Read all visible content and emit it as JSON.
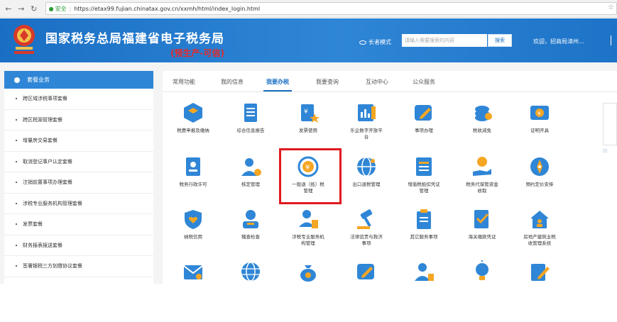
{
  "browser": {
    "security_label": "安全",
    "url": "https://etax99.fujian.chinatax.gov.cn/xxmh/html/index_login.html"
  },
  "header": {
    "title": "国家税务总局福建省电子税务局",
    "subtitle": "(预生产-可信)",
    "elder_mode": "长者模式",
    "search_placeholder": "请输入需要搜索的内容",
    "search_button": "搜索",
    "welcome": "欢迎，招商局漳州..."
  },
  "sidebar": {
    "title": "套餐业务",
    "items": [
      "跨区域涉税事项套餐",
      "跨区税源管理套餐",
      "增量房交易套餐",
      "取消登记事户认定套餐",
      "注销前置事项办理套餐",
      "涉税专业服务机构管理套餐",
      "发票套餐",
      "财务报表报送套餐",
      "签署银税三方划缴协议套餐"
    ]
  },
  "tabs": [
    "常用功能",
    "我的信息",
    "我要办税",
    "我要查询",
    "互动中心",
    "公众服务"
  ],
  "tiles": [
    {
      "label": "税费申报及缴纳",
      "icon": "cube-icon"
    },
    {
      "label": "综合信息报告",
      "icon": "document-icon"
    },
    {
      "label": "发票使用",
      "icon": "invoice-star-icon"
    },
    {
      "label": "乐企数字开放平\n台",
      "icon": "chart-doc-icon"
    },
    {
      "label": "事项办理",
      "icon": "edit-icon"
    },
    {
      "label": "税收减免",
      "icon": "coins-icon"
    },
    {
      "label": "证明开具",
      "icon": "certificate-icon"
    },
    {
      "label": "税务行政许可",
      "icon": "badge-doc-icon"
    },
    {
      "label": "核定管理",
      "icon": "user-gear-icon"
    },
    {
      "label": "一般退（抵）税\n管理",
      "icon": "refund-yuan-icon"
    },
    {
      "label": "出口退税管理",
      "icon": "globe-icon"
    },
    {
      "label": "增值税抵扣凭证\n管理",
      "icon": "ticket-icon"
    },
    {
      "label": "税务代保管资金\n收取",
      "icon": "hand-money-icon"
    },
    {
      "label": "预约定价安排",
      "icon": "compass-icon"
    },
    {
      "label": "纳税信用",
      "icon": "shield-heart-icon"
    },
    {
      "label": "稽查检查",
      "icon": "inspector-icon"
    },
    {
      "label": "涉税专业服务机\n构管理",
      "icon": "agent-doc-icon"
    },
    {
      "label": "法律追责与救济\n事项",
      "icon": "gavel-icon"
    },
    {
      "label": "其它服务事项",
      "icon": "clipboard-icon"
    },
    {
      "label": "海关缴款凭证",
      "icon": "check-doc-icon"
    },
    {
      "label": "房地产建筑业税\n收管理系统",
      "icon": "house-user-icon"
    },
    {
      "label": "",
      "icon": "mail-icon"
    },
    {
      "label": "",
      "icon": "world-icon"
    },
    {
      "label": "",
      "icon": "money-bag-icon"
    },
    {
      "label": "",
      "icon": "ticket-edit-icon"
    },
    {
      "label": "",
      "icon": "person-card-icon"
    },
    {
      "label": "",
      "icon": "bulb-icon"
    },
    {
      "label": "",
      "icon": "pen-doc-icon"
    }
  ],
  "colors": {
    "brand_blue": "#1a6fc4",
    "icon_blue": "#2f86d6",
    "icon_orange": "#f5a623",
    "highlight_red": "#e0191f",
    "subtitle_red": "#e22a2a"
  }
}
